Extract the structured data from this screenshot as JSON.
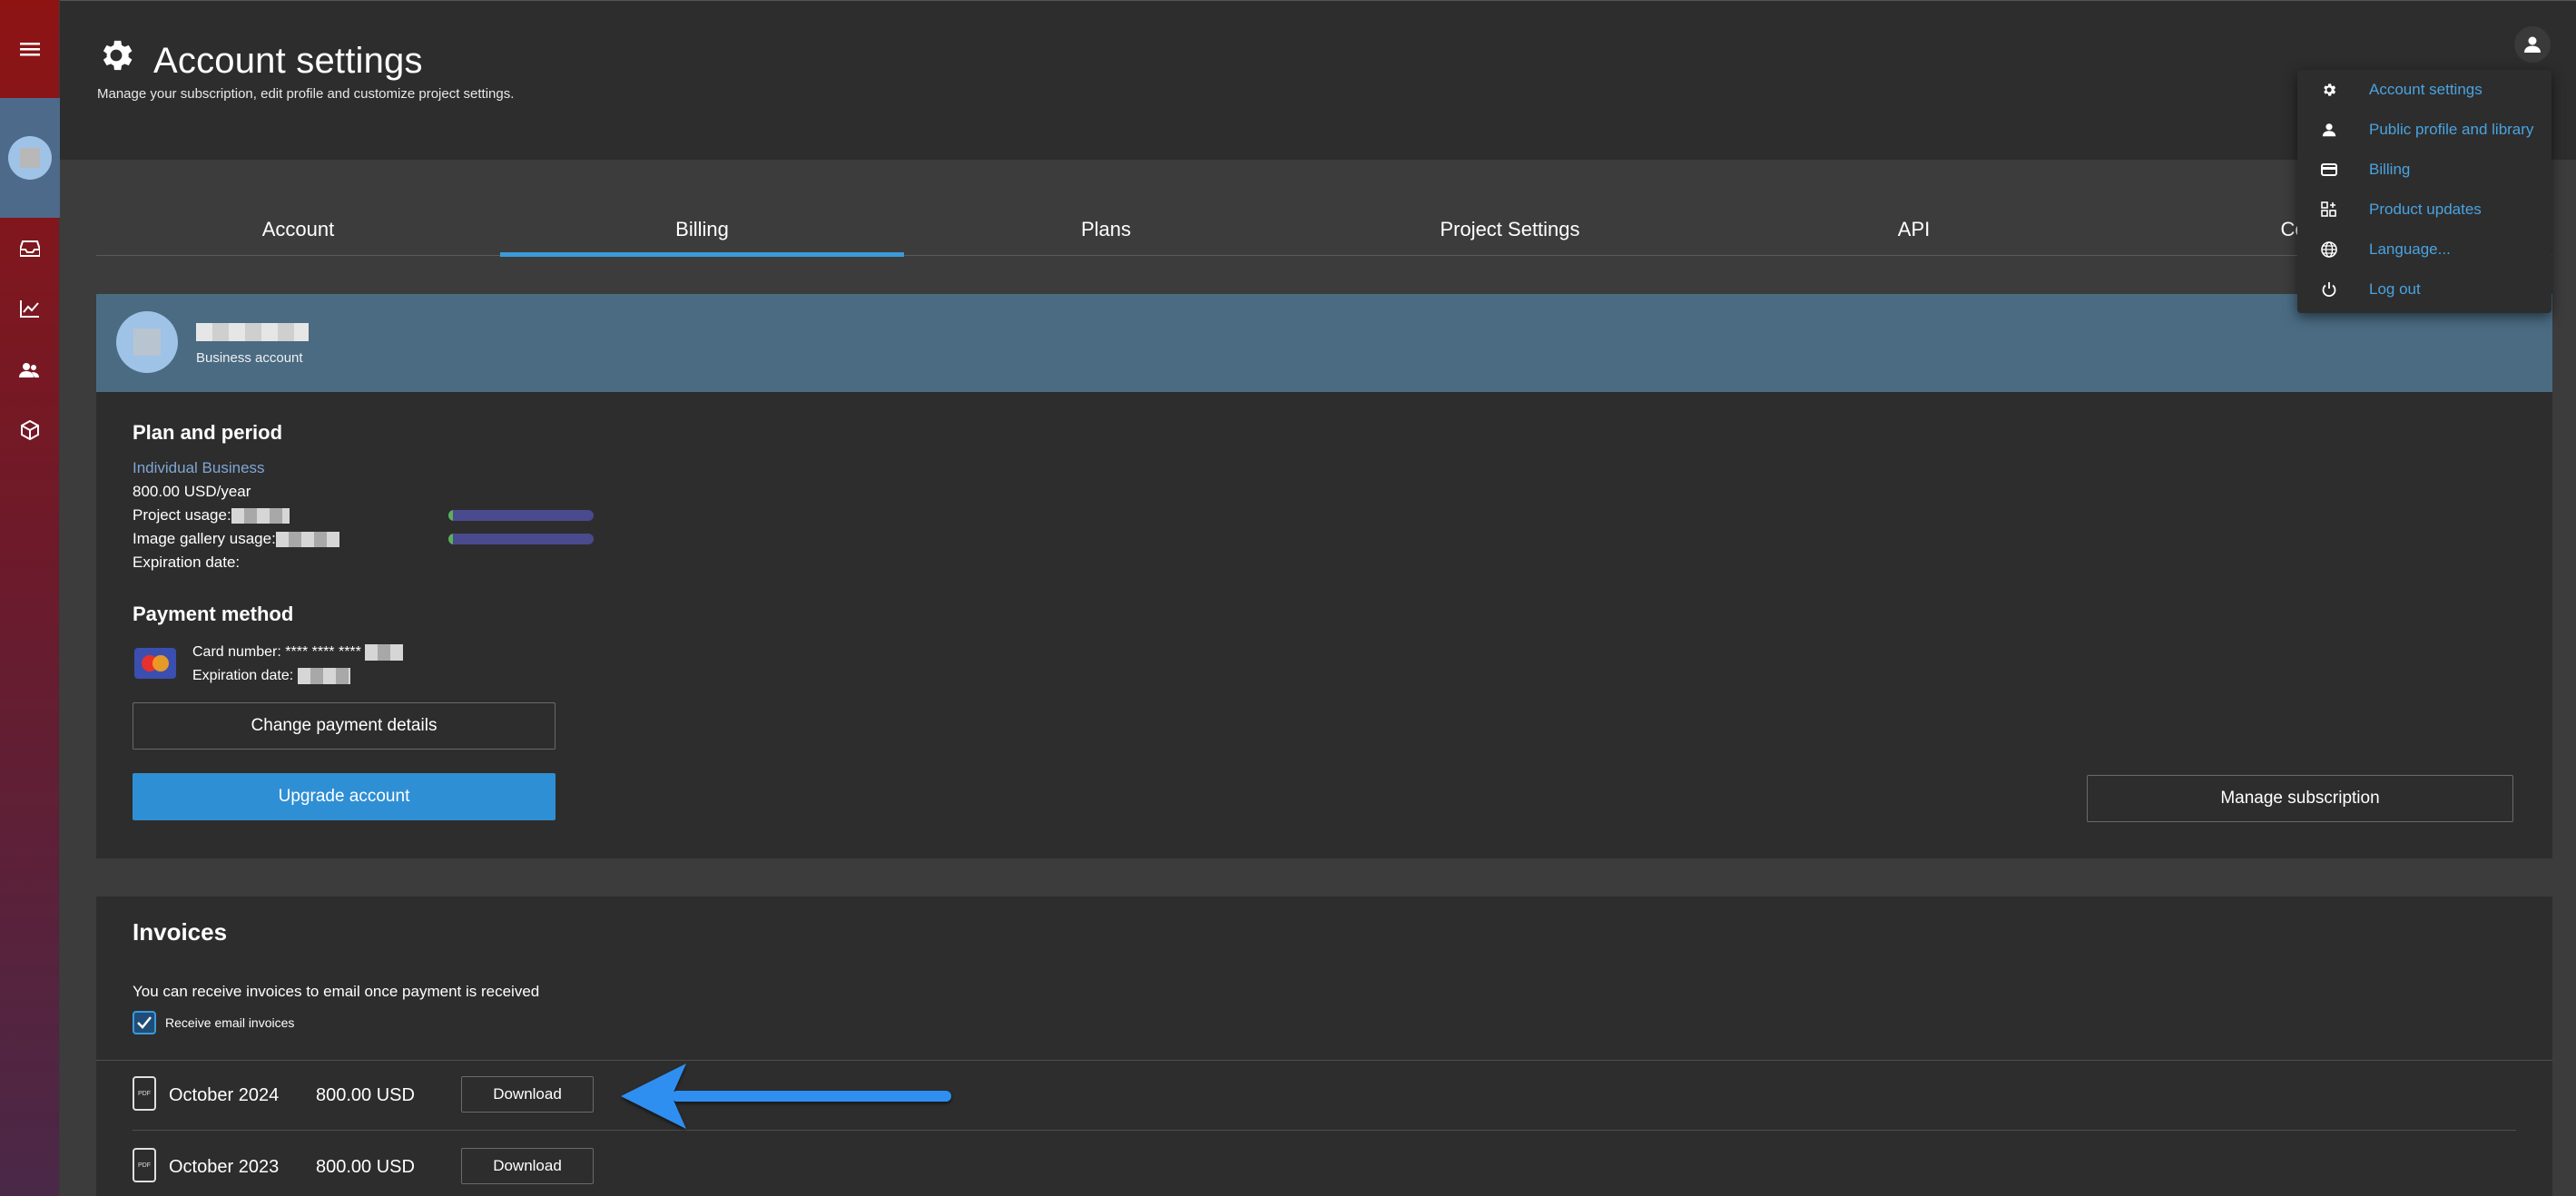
{
  "header": {
    "title": "Account settings",
    "subtitle": "Manage your subscription, edit profile and customize project settings."
  },
  "tabs": [
    {
      "label": "Account",
      "active": false
    },
    {
      "label": "Billing",
      "active": true
    },
    {
      "label": "Plans",
      "active": false
    },
    {
      "label": "Project Settings",
      "active": false
    },
    {
      "label": "API",
      "active": false
    },
    {
      "label": "Connect",
      "active": false
    }
  ],
  "account": {
    "type": "Business account"
  },
  "plan": {
    "heading": "Plan and period",
    "name": "Individual Business",
    "price": "800.00 USD/year",
    "project_usage_label": "Project usage:",
    "project_usage_fill": 0.03,
    "gallery_usage_label": "Image gallery usage:",
    "gallery_usage_fill": 0.03,
    "expiration_label": "Expiration date:"
  },
  "payment": {
    "heading": "Payment method",
    "card_number_label": "Card number: **** **** ****",
    "expiration_label": "Expiration date:",
    "change_button": "Change payment details",
    "upgrade_button": "Upgrade account",
    "manage_button": "Manage subscription"
  },
  "invoices": {
    "heading": "Invoices",
    "description": "You can receive invoices to email once payment is received",
    "checkbox_label": "Receive email invoices",
    "checkbox_checked": true,
    "rows": [
      {
        "date": "October 2024",
        "amount": "800.00 USD",
        "button": "Download"
      },
      {
        "date": "October 2023",
        "amount": "800.00 USD",
        "button": "Download"
      }
    ],
    "pdf_icon_text": "PDF"
  },
  "menu": {
    "items": [
      {
        "label": "Account settings",
        "icon": "gear-icon"
      },
      {
        "label": "Public profile and library",
        "icon": "person-icon"
      },
      {
        "label": "Billing",
        "icon": "card-icon"
      },
      {
        "label": "Product updates",
        "icon": "updates-icon"
      },
      {
        "label": "Language...",
        "icon": "globe-icon"
      },
      {
        "label": "Log out",
        "icon": "power-icon"
      }
    ]
  },
  "colors": {
    "accent": "#3b9ad9",
    "link": "#4aa3e0",
    "primary_button": "#2f8fd4",
    "account_band": "#4a6b82",
    "rail_top": "#8e1414"
  }
}
